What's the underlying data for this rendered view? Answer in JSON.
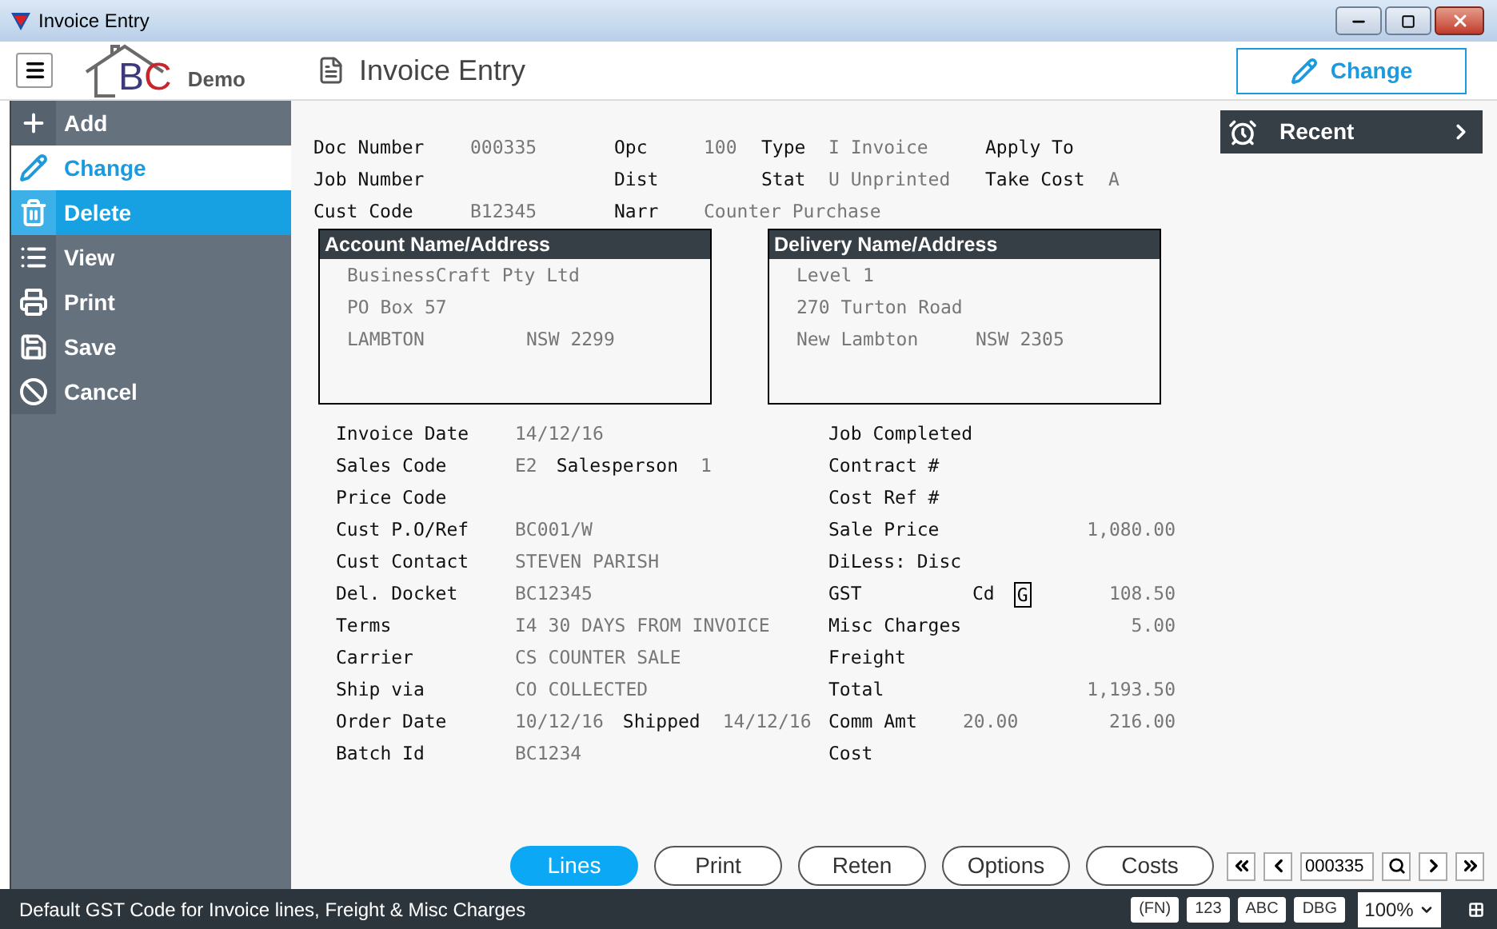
{
  "window": {
    "title": "Invoice Entry"
  },
  "header": {
    "logo_letters": "BC",
    "logo_label": "Demo",
    "page_title": "Invoice Entry",
    "action_button": "Change"
  },
  "sidebar": {
    "items": [
      {
        "kind": "add",
        "label": "Add",
        "selected": false,
        "hovered": false
      },
      {
        "kind": "change",
        "label": "Change",
        "selected": true,
        "hovered": false
      },
      {
        "kind": "delete",
        "label": "Delete",
        "selected": false,
        "hovered": true
      },
      {
        "kind": "view",
        "label": "View",
        "selected": false,
        "hovered": false
      },
      {
        "kind": "print",
        "label": "Print",
        "selected": false,
        "hovered": false
      },
      {
        "kind": "save",
        "label": "Save",
        "selected": false,
        "hovered": false
      },
      {
        "kind": "cancel",
        "label": "Cancel",
        "selected": false,
        "hovered": false
      }
    ]
  },
  "header_fields": [
    [
      {
        "label": "Doc Number",
        "value": "000335"
      },
      {
        "label": "Opc",
        "value": "100"
      },
      {
        "label": "Type",
        "value": "I Invoice"
      },
      {
        "label": "Apply To"
      }
    ],
    [
      {
        "label": "Job Number"
      },
      {
        "label": "Dist"
      },
      {
        "label": "Stat",
        "value": "U Unprinted"
      },
      {
        "label": "Take Cost",
        "value": "A"
      }
    ],
    [
      {
        "label": "Cust Code",
        "value": "B12345"
      },
      {
        "label": "Narr",
        "value": "Counter Purchase"
      }
    ]
  ],
  "addresses": [
    {
      "title": "Account Name/Address",
      "lines": [
        [
          "BusinessCraft Pty Ltd"
        ],
        [
          "PO Box 57"
        ],
        [
          "LAMBTON",
          "NSW 2299"
        ]
      ]
    },
    {
      "title": "Delivery Name/Address",
      "lines": [
        [
          "Level 1"
        ],
        [
          "270 Turton Road"
        ],
        [
          "New Lambton",
          "NSW 2305"
        ]
      ]
    }
  ],
  "details_left": [
    {
      "label": "Invoice Date",
      "value": "14/12/16"
    },
    {
      "label": "Sales Code",
      "value": "E2",
      "extra_label": "Salesperson",
      "extra_value": "1"
    },
    {
      "label": "Price Code"
    },
    {
      "label": "Cust P.O/Ref",
      "value": "BC001/W"
    },
    {
      "label": "Cust Contact",
      "value": "STEVEN PARISH"
    },
    {
      "label": "Del. Docket",
      "value": "BC12345"
    },
    {
      "label": "Terms",
      "value": "I4 30 DAYS FROM INVOICE"
    },
    {
      "label": "Carrier",
      "value": "CS COUNTER SALE"
    },
    {
      "label": "Ship via",
      "value": "CO COLLECTED"
    },
    {
      "label": "Order Date",
      "value": "10/12/16",
      "extra_label": "Shipped",
      "extra_value": "14/12/16"
    },
    {
      "label": "Batch Id",
      "value": "BC1234"
    }
  ],
  "details_right": [
    {
      "label": "Job Completed"
    },
    {
      "label": "Contract #"
    },
    {
      "label": "Cost Ref #"
    },
    {
      "label": "Sale Price",
      "amount": "1,080.00"
    },
    {
      "label": "DiLess: Disc"
    },
    {
      "label": "GST",
      "code_label": "Cd",
      "code": "G",
      "amount": "108.50"
    },
    {
      "label": "Misc Charges",
      "amount": "5.00"
    },
    {
      "label": "Freight"
    },
    {
      "label": "Total",
      "amount": "1,193.50"
    },
    {
      "label": "Comm Amt",
      "rate": "20.00",
      "amount": "216.00"
    },
    {
      "label": "Cost"
    }
  ],
  "recent": {
    "label": "Recent"
  },
  "bottom_buttons": [
    {
      "label": "Lines",
      "selected": true
    },
    {
      "label": "Print",
      "selected": false
    },
    {
      "label": "Reten",
      "selected": false
    },
    {
      "label": "Options",
      "selected": false
    },
    {
      "label": "Costs",
      "selected": false
    }
  ],
  "navigator": {
    "record": "000335"
  },
  "status_bar": {
    "message": "Default GST Code for Invoice lines, Freight & Misc Charges",
    "indicators": [
      "(FN)",
      "123",
      "ABC",
      "DBG"
    ],
    "zoom": "100%"
  }
}
